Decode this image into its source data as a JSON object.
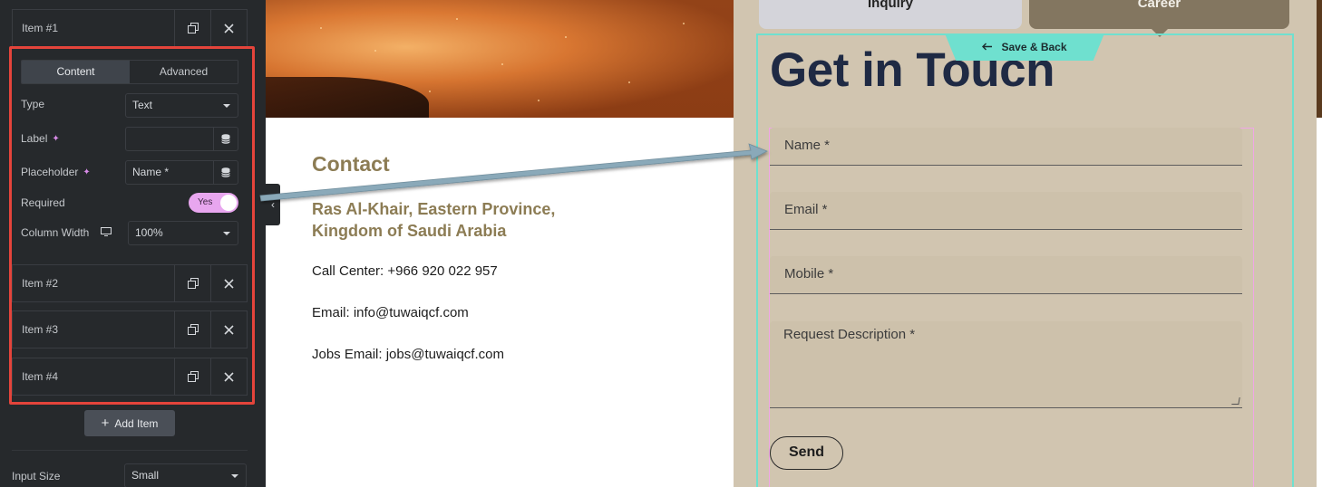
{
  "panel": {
    "items": [
      {
        "label": "Item #1"
      },
      {
        "label": "Item #2"
      },
      {
        "label": "Item #3"
      },
      {
        "label": "Item #4"
      }
    ],
    "tabs": {
      "content": "Content",
      "advanced": "Advanced"
    },
    "controls": {
      "type_label": "Type",
      "type_value": "Text",
      "label_label": "Label",
      "label_value": "",
      "placeholder_label": "Placeholder",
      "placeholder_value": "Name *",
      "required_label": "Required",
      "required_value": "Yes",
      "column_width_label": "Column Width",
      "column_width_value": "100%"
    },
    "add_item": "Add Item",
    "input_size_label": "Input Size",
    "input_size_value": "Small"
  },
  "content": {
    "heading": "Contact",
    "address_line1": "Ras Al-Khair, Eastern Province,",
    "address_line2": "Kingdom of Saudi Arabia",
    "call_center": "Call Center: +966 920 022 957",
    "email": "Email: info@tuwaiqcf.com",
    "jobs_email": "Jobs Email: jobs@tuwaiqcf.com"
  },
  "form": {
    "tabs": {
      "inquiry": "Inquiry",
      "career": "Career"
    },
    "save_back": "Save & Back",
    "title": "Get in Touch",
    "fields": {
      "name": "Name *",
      "email": "Email *",
      "mobile": "Mobile *",
      "description": "Request Description *"
    },
    "send": "Send"
  },
  "colors": {
    "panel_bg": "#26292c",
    "highlight": "#e4443b",
    "accent_teal": "#6fe0cf",
    "form_bg": "#d1c5b0",
    "title": "#1f2a44",
    "brand_gold": "#8c7c54",
    "toggle": "#e8a6ef",
    "arrow": "#8aa9b9"
  }
}
